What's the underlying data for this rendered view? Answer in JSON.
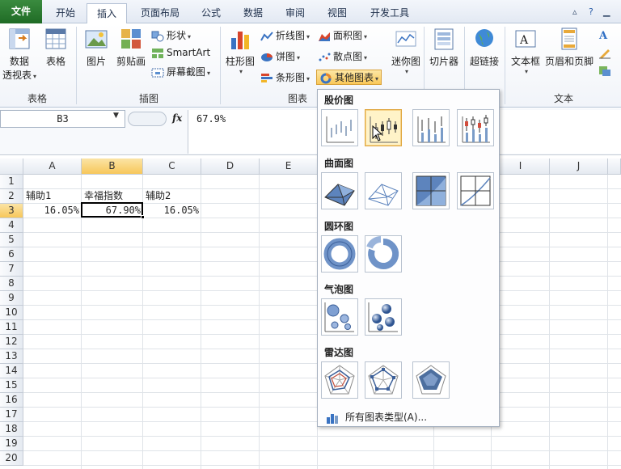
{
  "tabs": [
    {
      "label": "文件"
    },
    {
      "label": "开始"
    },
    {
      "label": "插入"
    },
    {
      "label": "页面布局"
    },
    {
      "label": "公式"
    },
    {
      "label": "数据"
    },
    {
      "label": "审阅"
    },
    {
      "label": "视图"
    },
    {
      "label": "开发工具"
    }
  ],
  "ribbon": {
    "tables": {
      "pivot_label_1": "数据",
      "pivot_label_2": "透视表",
      "table_label": "表格",
      "group": "表格"
    },
    "illustrations": {
      "picture": "图片",
      "clipart": "剪贴画",
      "shapes": "形状",
      "smartart": "SmartArt",
      "screenshot": "屏幕截图",
      "group": "插图"
    },
    "charts": {
      "column": "柱形图",
      "line": "折线图",
      "pie": "饼图",
      "bar": "条形图",
      "area": "面积图",
      "scatter": "散点图",
      "other": "其他图表",
      "group": "图表"
    },
    "sparklines": "迷你图",
    "slicer": "切片器",
    "hyperlink": "超链接",
    "textbox": "文本框",
    "header_footer": "页眉和页脚",
    "text_group": "文本"
  },
  "formula_bar": {
    "name_box": "B3",
    "fx": "fx",
    "formula": "67.9%"
  },
  "columns": [
    "A",
    "B",
    "C",
    "D",
    "E",
    "I",
    "J"
  ],
  "rows": [
    "1",
    "2",
    "3",
    "4",
    "5",
    "6",
    "7",
    "8",
    "9",
    "10",
    "11",
    "12",
    "13",
    "14",
    "15",
    "16",
    "17",
    "18",
    "19",
    "20"
  ],
  "cells": {
    "A2": "辅助1",
    "B2": "幸福指数",
    "C2": "辅助2",
    "A3": "16.05%",
    "B3": "67.90%",
    "C3": "16.05%"
  },
  "dropdown": {
    "stock": "股价图",
    "surface": "曲面图",
    "doughnut": "圆环图",
    "bubble": "气泡图",
    "radar": "雷达图",
    "all_types": "所有图表类型(A)..."
  },
  "colors": {
    "file_tab": "#2a7a30",
    "selected_header": "#f7c75a",
    "selected_thumb": "#fff3c8"
  }
}
